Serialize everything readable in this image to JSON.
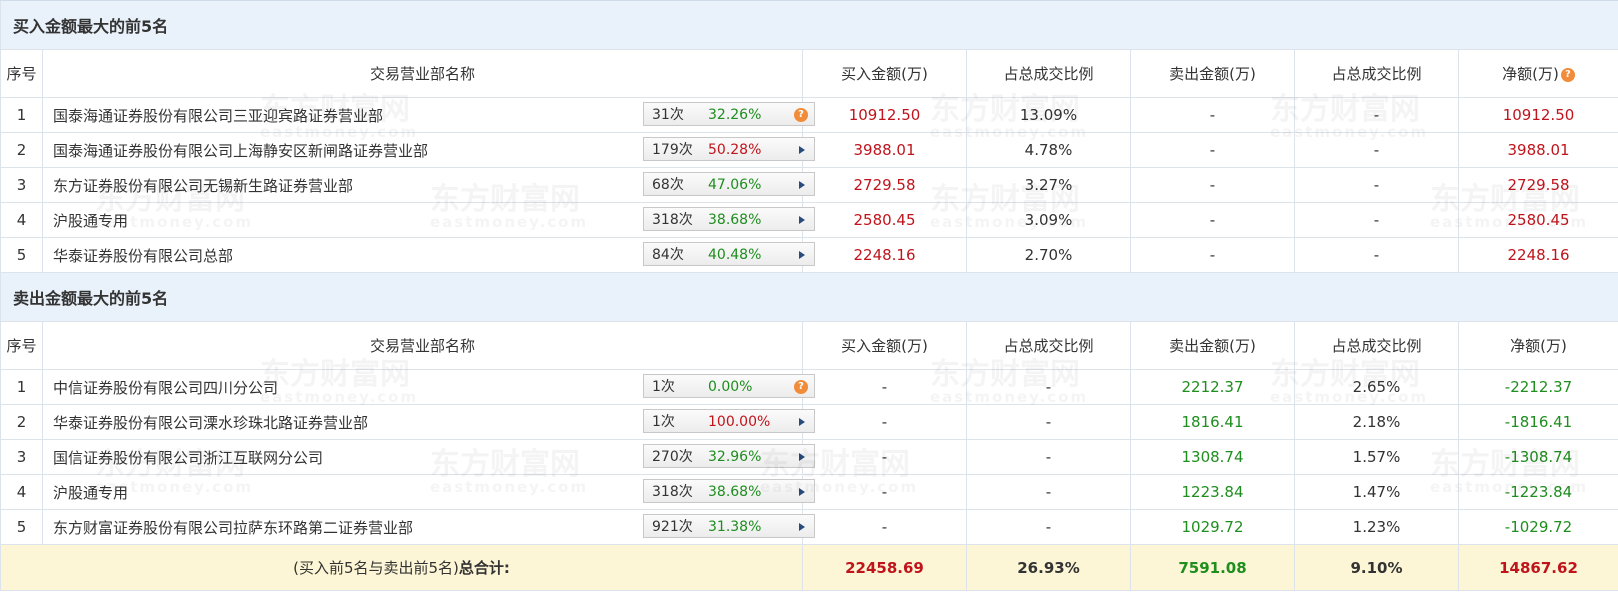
{
  "buy_section": {
    "title": "买入金额最大的前5名",
    "headers": [
      "序号",
      "交易营业部名称",
      "买入金额(万)",
      "占总成交比例",
      "卖出金额(万)",
      "占总成交比例",
      "净额(万)"
    ],
    "rows": [
      {
        "idx": "1",
        "name": "国泰海通证券股份有限公司三亚迎宾路证券营业部",
        "count": "31次",
        "pct": "32.26%",
        "pct_color": "green",
        "indicator": "question",
        "buy": "10912.50",
        "buy_ratio": "13.09%",
        "sell": "-",
        "sell_ratio": "-",
        "net": "10912.50"
      },
      {
        "idx": "2",
        "name": "国泰海通证券股份有限公司上海静安区新闸路证券营业部",
        "count": "179次",
        "pct": "50.28%",
        "pct_color": "red",
        "indicator": "arrow",
        "buy": "3988.01",
        "buy_ratio": "4.78%",
        "sell": "-",
        "sell_ratio": "-",
        "net": "3988.01"
      },
      {
        "idx": "3",
        "name": "东方证券股份有限公司无锡新生路证券营业部",
        "count": "68次",
        "pct": "47.06%",
        "pct_color": "green",
        "indicator": "arrow",
        "buy": "2729.58",
        "buy_ratio": "3.27%",
        "sell": "-",
        "sell_ratio": "-",
        "net": "2729.58"
      },
      {
        "idx": "4",
        "name": "沪股通专用",
        "count": "318次",
        "pct": "38.68%",
        "pct_color": "green",
        "indicator": "arrow",
        "buy": "2580.45",
        "buy_ratio": "3.09%",
        "sell": "-",
        "sell_ratio": "-",
        "net": "2580.45"
      },
      {
        "idx": "5",
        "name": "华泰证券股份有限公司总部",
        "count": "84次",
        "pct": "40.48%",
        "pct_color": "green",
        "indicator": "arrow",
        "buy": "2248.16",
        "buy_ratio": "2.70%",
        "sell": "-",
        "sell_ratio": "-",
        "net": "2248.16"
      }
    ]
  },
  "sell_section": {
    "title": "卖出金额最大的前5名",
    "headers": [
      "序号",
      "交易营业部名称",
      "买入金额(万)",
      "占总成交比例",
      "卖出金额(万)",
      "占总成交比例",
      "净额(万)"
    ],
    "rows": [
      {
        "idx": "1",
        "name": "中信证券股份有限公司四川分公司",
        "count": "1次",
        "pct": "0.00%",
        "pct_color": "green",
        "indicator": "question",
        "buy": "-",
        "buy_ratio": "-",
        "sell": "2212.37",
        "sell_ratio": "2.65%",
        "net": "-2212.37"
      },
      {
        "idx": "2",
        "name": "华泰证券股份有限公司溧水珍珠北路证券营业部",
        "count": "1次",
        "pct": "100.00%",
        "pct_color": "red",
        "indicator": "arrow",
        "buy": "-",
        "buy_ratio": "-",
        "sell": "1816.41",
        "sell_ratio": "2.18%",
        "net": "-1816.41"
      },
      {
        "idx": "3",
        "name": "国信证券股份有限公司浙江互联网分公司",
        "count": "270次",
        "pct": "32.96%",
        "pct_color": "green",
        "indicator": "arrow",
        "buy": "-",
        "buy_ratio": "-",
        "sell": "1308.74",
        "sell_ratio": "1.57%",
        "net": "-1308.74"
      },
      {
        "idx": "4",
        "name": "沪股通专用",
        "count": "318次",
        "pct": "38.68%",
        "pct_color": "green",
        "indicator": "arrow",
        "buy": "-",
        "buy_ratio": "-",
        "sell": "1223.84",
        "sell_ratio": "1.47%",
        "net": "-1223.84"
      },
      {
        "idx": "5",
        "name": "东方财富证券股份有限公司拉萨东环路第二证券营业部",
        "count": "921次",
        "pct": "31.38%",
        "pct_color": "green",
        "indicator": "arrow",
        "buy": "-",
        "buy_ratio": "-",
        "sell": "1029.72",
        "sell_ratio": "1.23%",
        "net": "-1029.72"
      }
    ]
  },
  "total": {
    "label_prefix": "(买入前5名与卖出前5名)",
    "label_bold": "总合计:",
    "buy": "22458.69",
    "buy_ratio": "26.93%",
    "sell": "7591.08",
    "sell_ratio": "9.10%",
    "net": "14867.62"
  },
  "watermark": {
    "cn": "东方财富网",
    "en": "eastmoney.com"
  },
  "colors": {
    "red": "#c0141c",
    "green": "#1e8e1e",
    "header_bg": "#e9f2fb",
    "total_bg": "#fdf6d6",
    "indicator": "#f08c3a"
  }
}
